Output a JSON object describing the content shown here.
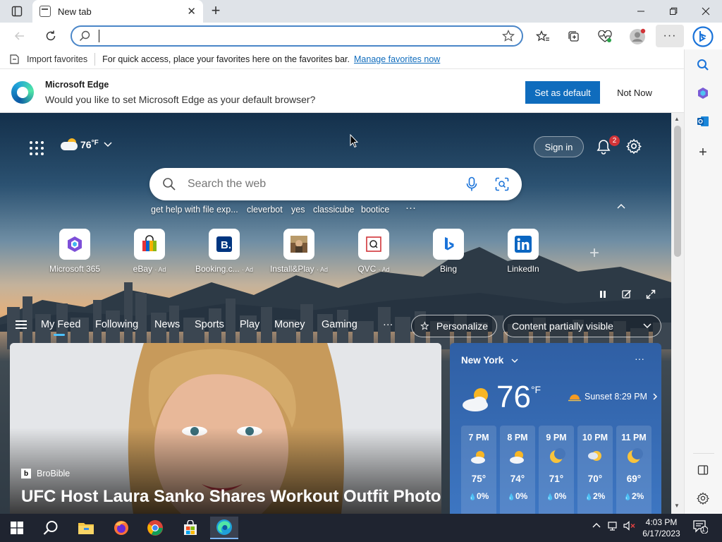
{
  "browser": {
    "tab_title": "New tab",
    "address_placeholder": "",
    "favorites_bar": {
      "import_label": "Import favorites",
      "hint": "For quick access, place your favorites here on the favorites bar.",
      "manage_link": "Manage favorites now"
    },
    "infobar": {
      "title": "Microsoft Edge",
      "message": "Would you like to set Microsoft Edge as your default browser?",
      "primary_label": "Set as default",
      "secondary_label": "Not Now"
    }
  },
  "newtab": {
    "weather_temp": "76",
    "weather_unit": "°F",
    "signin_label": "Sign in",
    "notification_count": "2",
    "search_placeholder": "Search the web",
    "trending": [
      "get help with file exp...",
      "cleverbot",
      "yes",
      "classicube",
      "bootice",
      "···"
    ],
    "quick_links": [
      {
        "label": "Microsoft 365",
        "ad": ""
      },
      {
        "label": "eBay",
        "ad": "· Ad"
      },
      {
        "label": "Booking.c...",
        "ad": "· Ad"
      },
      {
        "label": "Install&Play",
        "ad": "· Ad"
      },
      {
        "label": "QVC",
        "ad": "· Ad"
      },
      {
        "label": "Bing",
        "ad": ""
      },
      {
        "label": "LinkedIn",
        "ad": ""
      }
    ],
    "feed_tabs": [
      "My Feed",
      "Following",
      "News",
      "Sports",
      "Play",
      "Money",
      "Gaming"
    ],
    "feed_more": "···",
    "personalize_label": "Personalize",
    "content_visibility_label": "Content partially visible",
    "news": {
      "source": "BroBible",
      "source_initial": "b",
      "headline": "UFC Host Laura Sanko Shares Workout Outfit Photo"
    },
    "weather_card": {
      "location": "New York",
      "temp": "76",
      "unit": "°F",
      "sunset": "Sunset 8:29 PM",
      "more": "···",
      "hours": [
        {
          "time": "7 PM",
          "temp": "75°",
          "precip": "0%"
        },
        {
          "time": "8 PM",
          "temp": "74°",
          "precip": "0%"
        },
        {
          "time": "9 PM",
          "temp": "71°",
          "precip": "0%"
        },
        {
          "time": "10 PM",
          "temp": "70°",
          "precip": "2%"
        },
        {
          "time": "11 PM",
          "temp": "69°",
          "precip": "2%"
        }
      ]
    }
  },
  "taskbar": {
    "time": "4:03 PM",
    "date": "6/17/2023",
    "notification_count": "1"
  },
  "colors": {
    "accent": "#0f6cbd",
    "taskbar": "#1f2430",
    "badge": "#d13438"
  }
}
